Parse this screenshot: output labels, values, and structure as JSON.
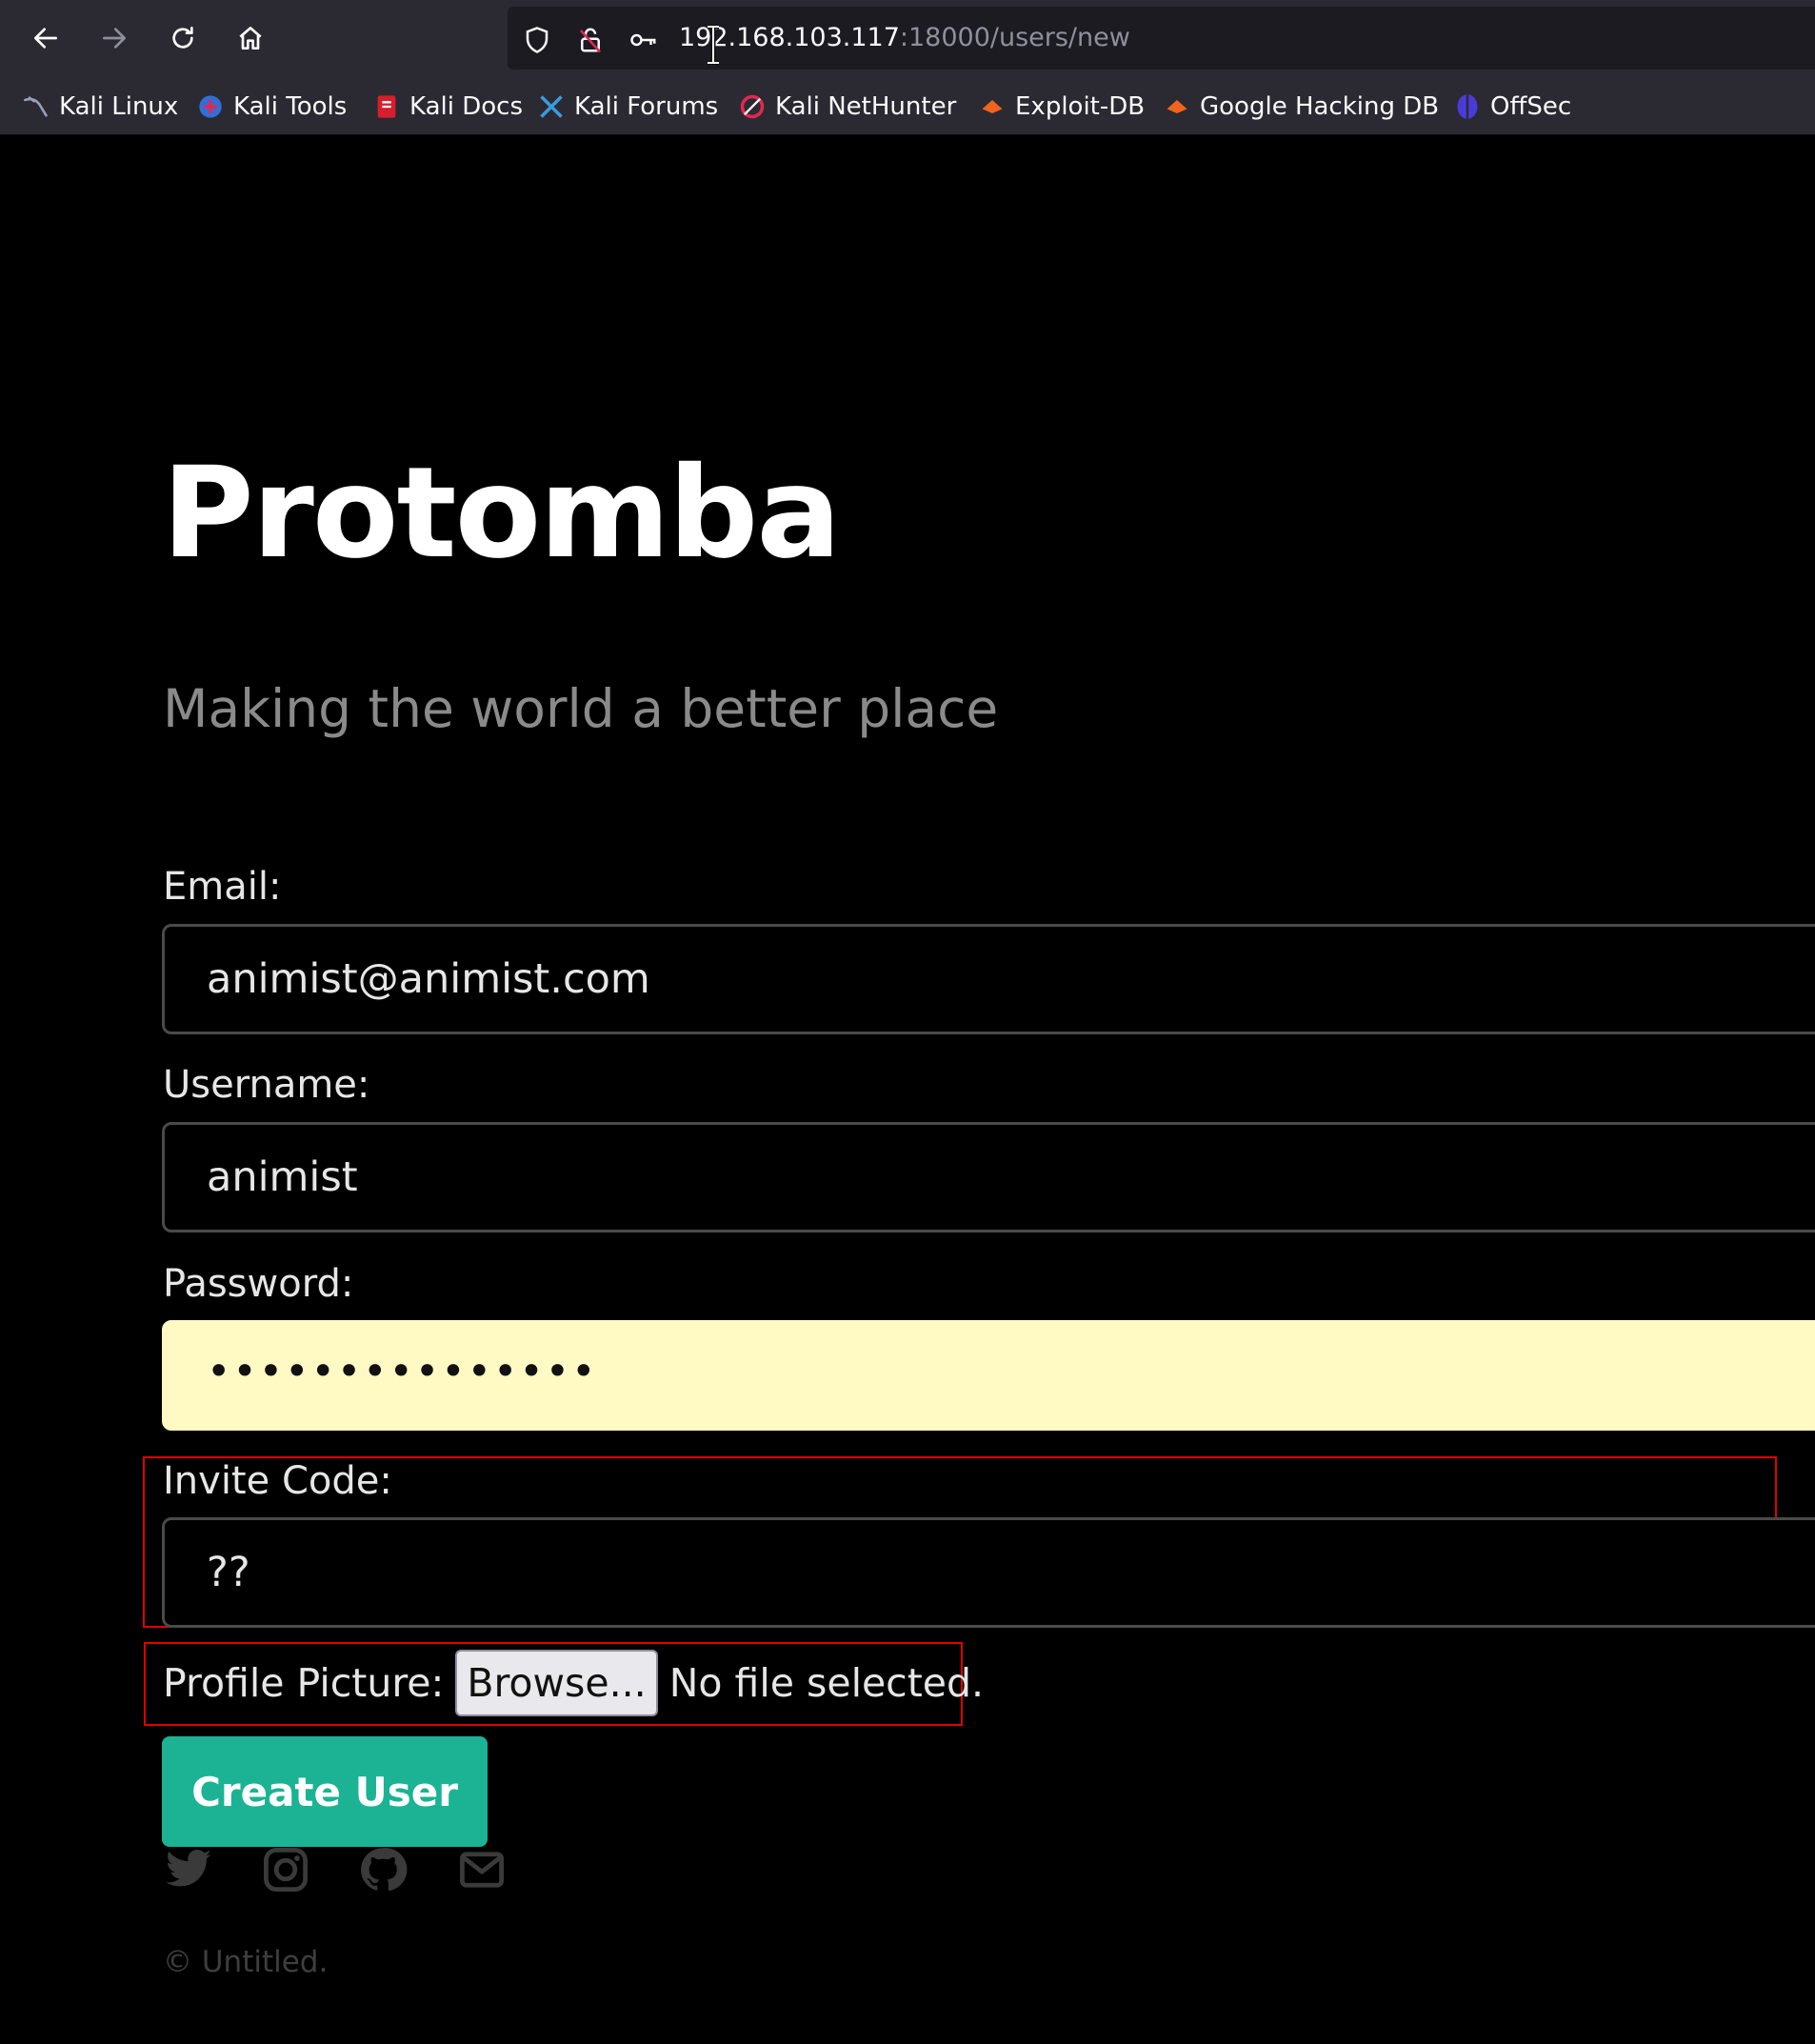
{
  "browser": {
    "url_host": "192.168.103.117",
    "url_path": ":18000/users/new",
    "bookmarks": [
      {
        "label": "Kali Linux",
        "icon": "kali-dragon-icon"
      },
      {
        "label": "Kali Tools",
        "icon": "kali-tools-icon"
      },
      {
        "label": "Kali Docs",
        "icon": "kali-docs-icon"
      },
      {
        "label": "Kali Forums",
        "icon": "kali-forums-icon"
      },
      {
        "label": "Kali NetHunter",
        "icon": "kali-nethunter-icon"
      },
      {
        "label": "Exploit-DB",
        "icon": "exploit-db-icon"
      },
      {
        "label": "Google Hacking DB",
        "icon": "ghdb-icon"
      },
      {
        "label": "OffSec",
        "icon": "offsec-icon"
      }
    ]
  },
  "page": {
    "title": "Protomba",
    "subtitle": "Making the world a better place"
  },
  "form": {
    "email_label": "Email:",
    "email_value": "animist@animist.com",
    "username_label": "Username:",
    "username_value": "animist",
    "password_label": "Password:",
    "password_value": "•••••••••••••••",
    "invite_label": "Invite Code:",
    "invite_value": "??",
    "picture_label": "Profile Picture:",
    "browse_label": "Browse...",
    "file_status": "No file selected.",
    "submit_label": "Create User"
  },
  "footer": {
    "social_icons": [
      "twitter-icon",
      "instagram-icon",
      "github-icon",
      "envelope-icon"
    ],
    "copyright": "© Untitled."
  },
  "colors": {
    "accent": "#1bb394",
    "annotation": "#e00000",
    "autofill": "#fff9c4"
  }
}
